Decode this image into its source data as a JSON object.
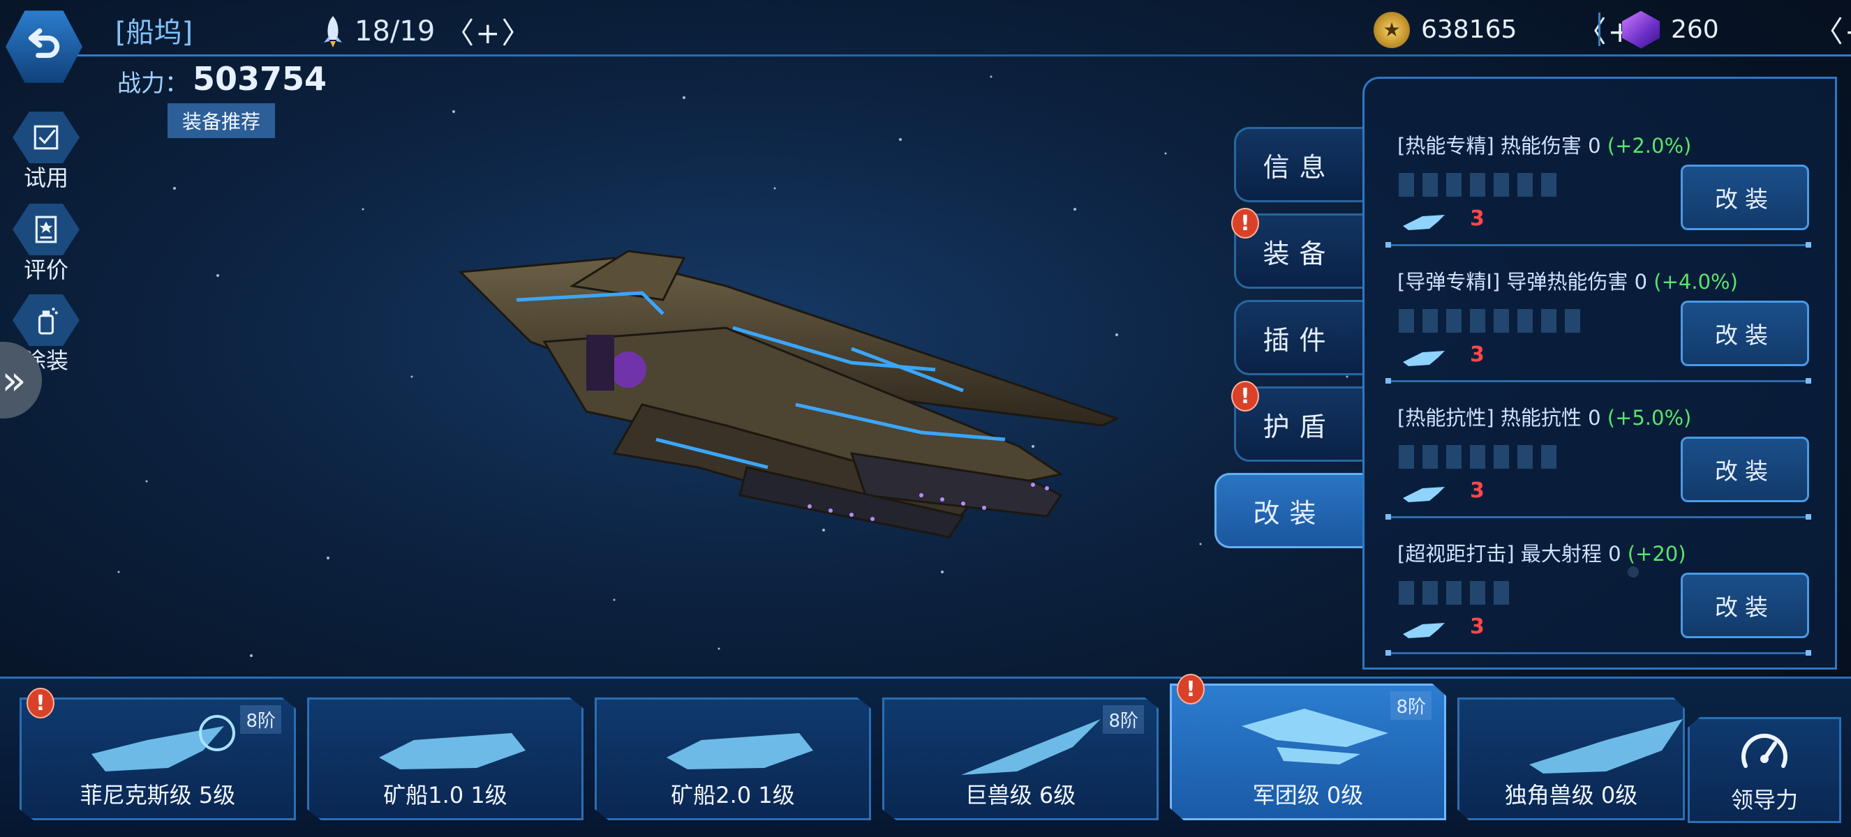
{
  "header": {
    "title": "[船坞]",
    "fleet_count": "18/19",
    "fleet_add": "〈+〉",
    "power_label": "战力：",
    "power_value": "503754",
    "recommend_label": "装备推荐"
  },
  "currencies": [
    {
      "icon": "coin-icon",
      "value": "638165",
      "add": "〈+〉"
    },
    {
      "icon": "gem-icon",
      "value": "260",
      "add": "〈+〉"
    }
  ],
  "side_menu": [
    {
      "label": "试用",
      "icon": "checkbox-icon"
    },
    {
      "label": "评价",
      "icon": "badge-icon"
    },
    {
      "label": "涂装",
      "icon": "spray-can-icon"
    }
  ],
  "side_expand_glyph": "»",
  "tabs": [
    {
      "label": "信息",
      "alert": false,
      "active": false
    },
    {
      "label": "装备",
      "alert": true,
      "active": false
    },
    {
      "label": "插件",
      "alert": false,
      "active": false
    },
    {
      "label": "护盾",
      "alert": true,
      "active": false
    },
    {
      "label": "改装",
      "alert": false,
      "active": true
    }
  ],
  "alert_glyph": "!",
  "mods": [
    {
      "title": "[热能专精] 热能伤害 0",
      "bonus": "(+2.0%)",
      "slots": 7,
      "cost": "3",
      "button": "改装"
    },
    {
      "title": "[导弹专精I] 导弹热能伤害 0",
      "bonus": "(+4.0%)",
      "slots": 8,
      "cost": "3",
      "button": "改装"
    },
    {
      "title": "[热能抗性] 热能抗性 0",
      "bonus": "(+5.0%)",
      "slots": 7,
      "cost": "3",
      "button": "改装"
    },
    {
      "title": "[超视距打击] 最大射程 0",
      "bonus": "(+20)",
      "slots": 5,
      "cost": "3",
      "button": "改装"
    }
  ],
  "ships": [
    {
      "label": "菲尼克斯级 5级",
      "tier": "8阶",
      "alert": true,
      "active": false
    },
    {
      "label": "矿船1.0 1级",
      "tier": "",
      "alert": false,
      "active": false
    },
    {
      "label": "矿船2.0 1级",
      "tier": "",
      "alert": false,
      "active": false
    },
    {
      "label": "巨兽级 6级",
      "tier": "8阶",
      "alert": false,
      "active": false
    },
    {
      "label": "军团级 0级",
      "tier": "8阶",
      "alert": true,
      "active": true
    },
    {
      "label": "独角兽级 0级",
      "tier": "",
      "alert": false,
      "active": false
    }
  ],
  "leadership": {
    "label": "领导力",
    "icon": "gauge-icon"
  },
  "colors": {
    "accent": "#2b7fd0",
    "bonus": "#58e56c",
    "cost": "#ff4848",
    "alert": "#d94129"
  }
}
